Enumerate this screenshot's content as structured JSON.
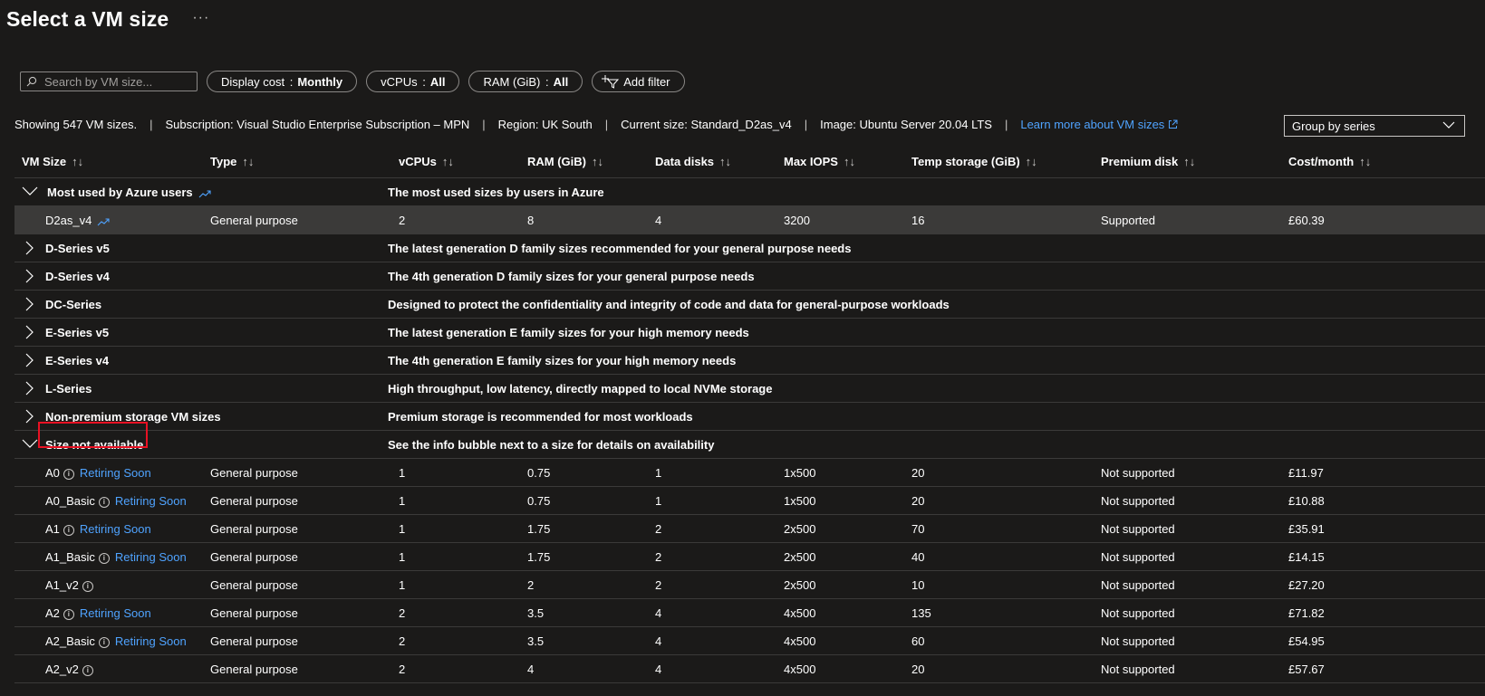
{
  "header": {
    "title": "Select a VM size",
    "more": "···"
  },
  "toolbar": {
    "search_placeholder": "Search by VM size...",
    "display_cost_label": "Display cost",
    "display_cost_value": "Monthly",
    "vcpus_label": "vCPUs",
    "vcpus_value": "All",
    "ram_label": "RAM (GiB)",
    "ram_value": "All",
    "add_filter": "Add filter",
    "colon": ":"
  },
  "info": {
    "showing": "Showing 547 VM sizes.",
    "subscription": "Subscription: Visual Studio Enterprise Subscription – MPN",
    "region": "Region: UK South",
    "current_size": "Current size: Standard_D2as_v4",
    "image": "Image: Ubuntu Server 20.04 LTS",
    "learn_more": "Learn more about VM sizes",
    "separator": "|"
  },
  "group_by": {
    "selected": "Group by series"
  },
  "columns": {
    "vm_size": "VM Size",
    "type": "Type",
    "vcpus": "vCPUs",
    "ram": "RAM (GiB)",
    "data_disks": "Data disks",
    "max_iops": "Max IOPS",
    "temp_storage": "Temp storage (GiB)",
    "premium_disk": "Premium disk",
    "cost": "Cost/month",
    "sort": "↑↓"
  },
  "groups": {
    "most_used": {
      "name": "Most used by Azure users",
      "desc": "The most used sizes by users in Azure"
    },
    "d5": {
      "name": "D-Series v5",
      "desc": "The latest generation D family sizes recommended for your general purpose needs"
    },
    "d4": {
      "name": "D-Series v4",
      "desc": "The 4th generation D family sizes for your general purpose needs"
    },
    "dc": {
      "name": "DC-Series",
      "desc": "Designed to protect the confidentiality and integrity of code and data for general-purpose workloads"
    },
    "e5": {
      "name": "E-Series v5",
      "desc": "The latest generation E family sizes for your high memory needs"
    },
    "e4": {
      "name": "E-Series v4",
      "desc": "The 4th generation E family sizes for your high memory needs"
    },
    "l": {
      "name": "L-Series",
      "desc": "High throughput, low latency, directly mapped to local NVMe storage"
    },
    "nonprem": {
      "name": "Non-premium storage VM sizes",
      "desc": "Premium storage is recommended for most workloads"
    },
    "na": {
      "name": "Size not available",
      "desc": "See the info bubble next to a size for details on availability"
    }
  },
  "selected_row": {
    "size": "D2as_v4",
    "type": "General purpose",
    "vcpus": "2",
    "ram": "8",
    "disks": "4",
    "iops": "3200",
    "temp": "16",
    "premium": "Supported",
    "cost": "£60.39"
  },
  "rows": [
    {
      "size": "A0",
      "retire": "Retiring Soon",
      "type": "General purpose",
      "vcpus": "1",
      "ram": "0.75",
      "disks": "1",
      "iops": "1x500",
      "temp": "20",
      "premium": "Not supported",
      "cost": "£11.97"
    },
    {
      "size": "A0_Basic",
      "retire": "Retiring Soon",
      "type": "General purpose",
      "vcpus": "1",
      "ram": "0.75",
      "disks": "1",
      "iops": "1x500",
      "temp": "20",
      "premium": "Not supported",
      "cost": "£10.88"
    },
    {
      "size": "A1",
      "retire": "Retiring Soon",
      "type": "General purpose",
      "vcpus": "1",
      "ram": "1.75",
      "disks": "2",
      "iops": "2x500",
      "temp": "70",
      "premium": "Not supported",
      "cost": "£35.91"
    },
    {
      "size": "A1_Basic",
      "retire": "Retiring Soon",
      "type": "General purpose",
      "vcpus": "1",
      "ram": "1.75",
      "disks": "2",
      "iops": "2x500",
      "temp": "40",
      "premium": "Not supported",
      "cost": "£14.15"
    },
    {
      "size": "A1_v2",
      "retire": "",
      "type": "General purpose",
      "vcpus": "1",
      "ram": "2",
      "disks": "2",
      "iops": "2x500",
      "temp": "10",
      "premium": "Not supported",
      "cost": "£27.20"
    },
    {
      "size": "A2",
      "retire": "Retiring Soon",
      "type": "General purpose",
      "vcpus": "2",
      "ram": "3.5",
      "disks": "4",
      "iops": "4x500",
      "temp": "135",
      "premium": "Not supported",
      "cost": "£71.82"
    },
    {
      "size": "A2_Basic",
      "retire": "Retiring Soon",
      "type": "General purpose",
      "vcpus": "2",
      "ram": "3.5",
      "disks": "4",
      "iops": "4x500",
      "temp": "60",
      "premium": "Not supported",
      "cost": "£54.95"
    },
    {
      "size": "A2_v2",
      "retire": "",
      "type": "General purpose",
      "vcpus": "2",
      "ram": "4",
      "disks": "4",
      "iops": "4x500",
      "temp": "20",
      "premium": "Not supported",
      "cost": "£57.67"
    }
  ],
  "icons": {
    "info": "i",
    "trend": "trending-up-icon",
    "link_color": "#4fa3ff",
    "highlight_color": "#e81123"
  }
}
